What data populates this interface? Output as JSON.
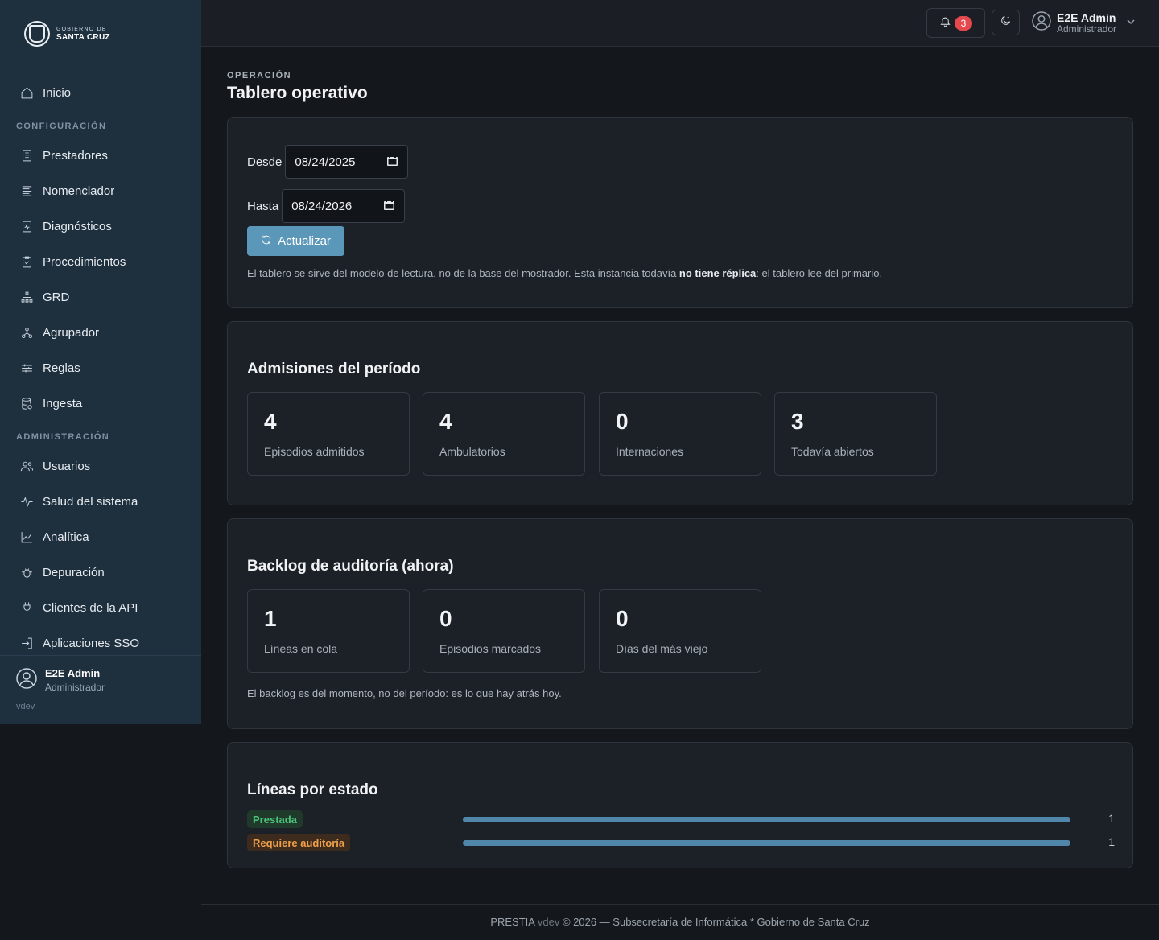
{
  "brand": {
    "line1": "GOBIERNO DE",
    "line2": "SANTA CRUZ"
  },
  "sidebar": {
    "items_top": [
      {
        "label": "Inicio",
        "icon": "home-icon"
      }
    ],
    "section_config": "CONFIGURACIÓN",
    "items_config": [
      {
        "label": "Prestadores",
        "icon": "building-icon"
      },
      {
        "label": "Nomenclador",
        "icon": "list-icon"
      },
      {
        "label": "Diagnósticos",
        "icon": "file-pulse-icon"
      },
      {
        "label": "Procedimientos",
        "icon": "clipboard-check-icon"
      },
      {
        "label": "GRD",
        "icon": "hierarchy-icon"
      },
      {
        "label": "Agrupador",
        "icon": "group-icon"
      },
      {
        "label": "Reglas",
        "icon": "sliders-icon"
      },
      {
        "label": "Ingesta",
        "icon": "database-icon"
      }
    ],
    "section_admin": "ADMINISTRACIÓN",
    "items_admin": [
      {
        "label": "Usuarios",
        "icon": "users-icon"
      },
      {
        "label": "Salud del sistema",
        "icon": "activity-icon"
      },
      {
        "label": "Analítica",
        "icon": "chart-line-icon"
      },
      {
        "label": "Depuración",
        "icon": "bug-icon"
      },
      {
        "label": "Clientes de la API",
        "icon": "plug-icon"
      },
      {
        "label": "Aplicaciones SSO",
        "icon": "login-icon"
      }
    ],
    "user": {
      "name": "E2E Admin",
      "role": "Administrador"
    },
    "version": "vdev"
  },
  "topbar": {
    "notifications_count": "3",
    "user": {
      "name": "E2E Admin",
      "role": "Administrador"
    }
  },
  "page": {
    "eyebrow": "OPERACIÓN",
    "title": "Tablero operativo"
  },
  "filters": {
    "from_label": "Desde",
    "from_value": "08/24/2025",
    "to_label": "Hasta",
    "to_value": "08/24/2026",
    "refresh_label": "Actualizar",
    "note_pre": "El tablero se sirve del modelo de lectura, no de la base del mostrador. Esta instancia todavía ",
    "note_bold": "no tiene réplica",
    "note_post": ": el tablero lee del primario."
  },
  "admissions": {
    "title": "Admisiones del período",
    "stats": [
      {
        "value": "4",
        "label": "Episodios admitidos"
      },
      {
        "value": "4",
        "label": "Ambulatorios"
      },
      {
        "value": "0",
        "label": "Internaciones"
      },
      {
        "value": "3",
        "label": "Todavía abiertos"
      }
    ]
  },
  "backlog": {
    "title": "Backlog de auditoría (ahora)",
    "stats": [
      {
        "value": "1",
        "label": "Líneas en cola"
      },
      {
        "value": "0",
        "label": "Episodios marcados"
      },
      {
        "value": "0",
        "label": "Días del más viejo"
      }
    ],
    "note": "El backlog es del momento, no del período: es lo que hay atrás hoy."
  },
  "states": {
    "title": "Líneas por estado",
    "rows": [
      {
        "label": "Prestada",
        "count": "1",
        "fraction": 1.0,
        "color": "#4cc37b"
      },
      {
        "label": "Requiere auditoría",
        "count": "1",
        "fraction": 1.0,
        "color": "#f0a04b"
      }
    ]
  },
  "footer": {
    "app": "PRESTIA",
    "version": "vdev",
    "rest": "© 2026 — Subsecretaría de Informática * Gobierno de Santa Cruz"
  }
}
